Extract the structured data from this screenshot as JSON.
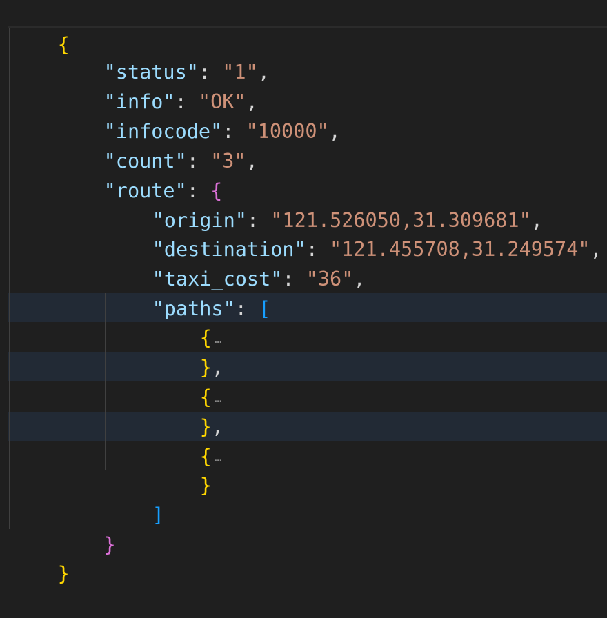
{
  "editor": {
    "language": "json",
    "colors": {
      "background": "#1f1f1f",
      "key": "#9cdcfe",
      "string": "#ce9178",
      "bracket_level1": "#ffd700",
      "bracket_level2": "#da70d6",
      "bracket_level3": "#179fff",
      "folded_line_highlight": "#222a35"
    },
    "punct": {
      "colon": ": ",
      "comma": ",",
      "ellipsis": "…"
    },
    "root": {
      "open": "{",
      "close": "}"
    },
    "fields": [
      {
        "key": "\"status\"",
        "value": "\"1\""
      },
      {
        "key": "\"info\"",
        "value": "\"OK\""
      },
      {
        "key": "\"infocode\"",
        "value": "\"10000\""
      },
      {
        "key": "\"count\"",
        "value": "\"3\""
      }
    ],
    "route": {
      "key": "\"route\"",
      "open": "{",
      "close": "}",
      "fields": [
        {
          "key": "\"origin\"",
          "value": "\"121.526050,31.309681\""
        },
        {
          "key": "\"destination\"",
          "value": "\"121.455708,31.249574\""
        },
        {
          "key": "\"taxi_cost\"",
          "value": "\"36\""
        }
      ],
      "paths": {
        "key": "\"paths\"",
        "open": "[",
        "close": "]",
        "items": [
          {
            "open": "{",
            "close": "}",
            "trailing": ","
          },
          {
            "open": "{",
            "close": "}",
            "trailing": ","
          },
          {
            "open": "{",
            "close": "}",
            "trailing": ""
          }
        ]
      }
    }
  }
}
